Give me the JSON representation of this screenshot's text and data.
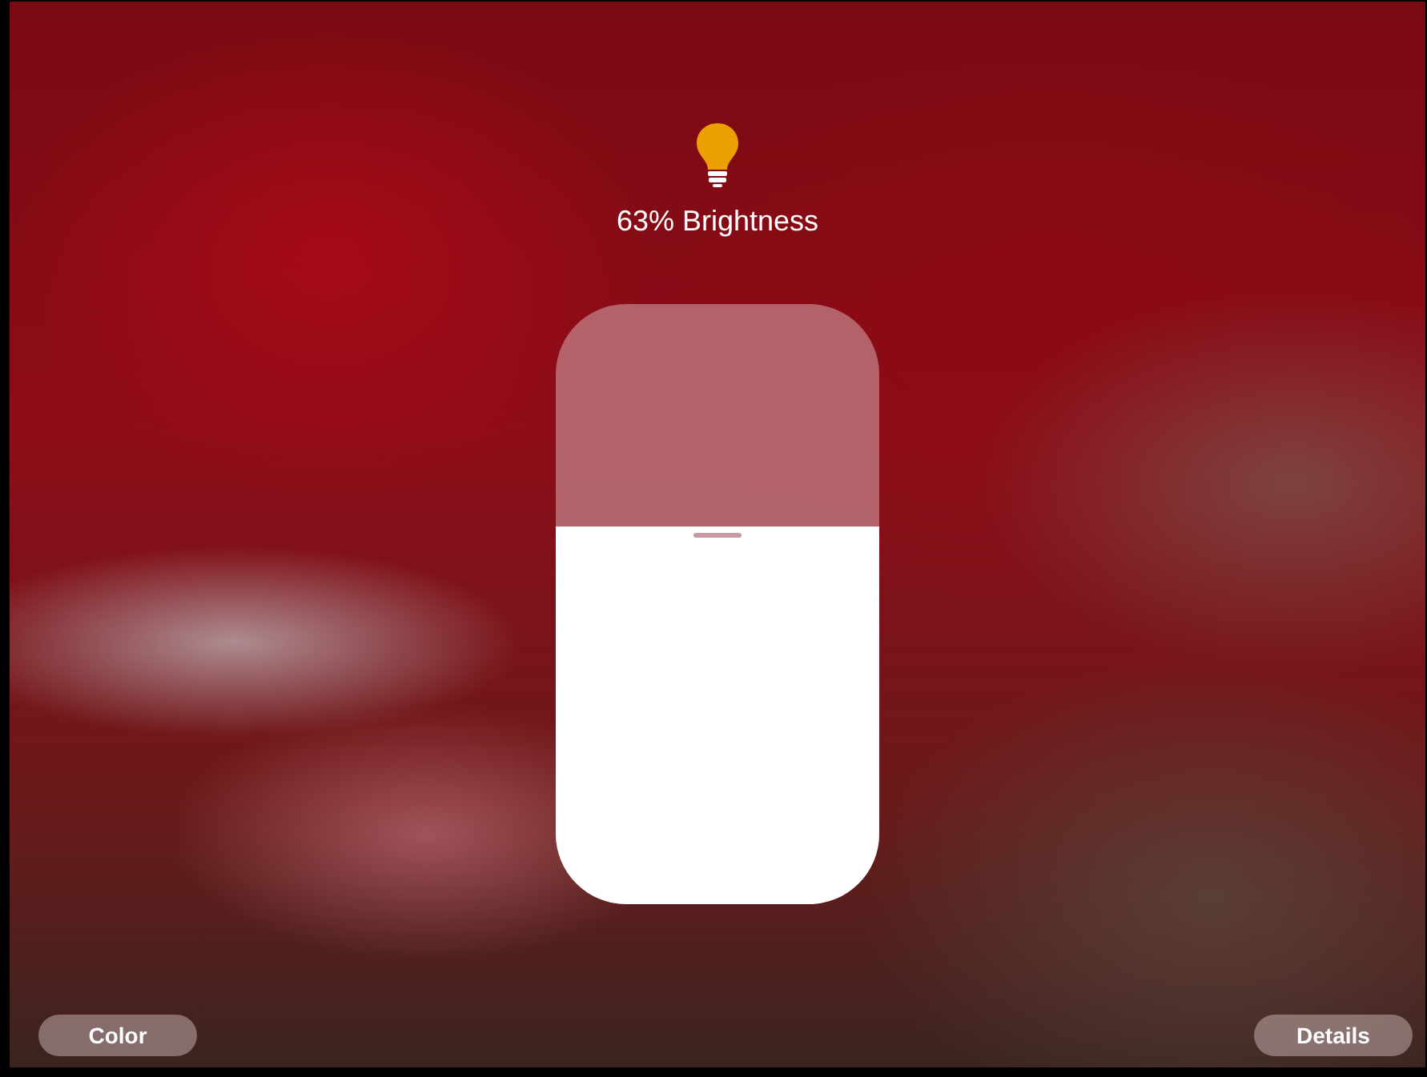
{
  "light": {
    "brightness_label": "63% Brightness",
    "on": true
  },
  "slider": {
    "level": 0.63
  },
  "buttons": [
    {
      "label": "Color",
      "kind": "left"
    },
    {
      "label": "Details",
      "kind": "right"
    }
  ]
}
